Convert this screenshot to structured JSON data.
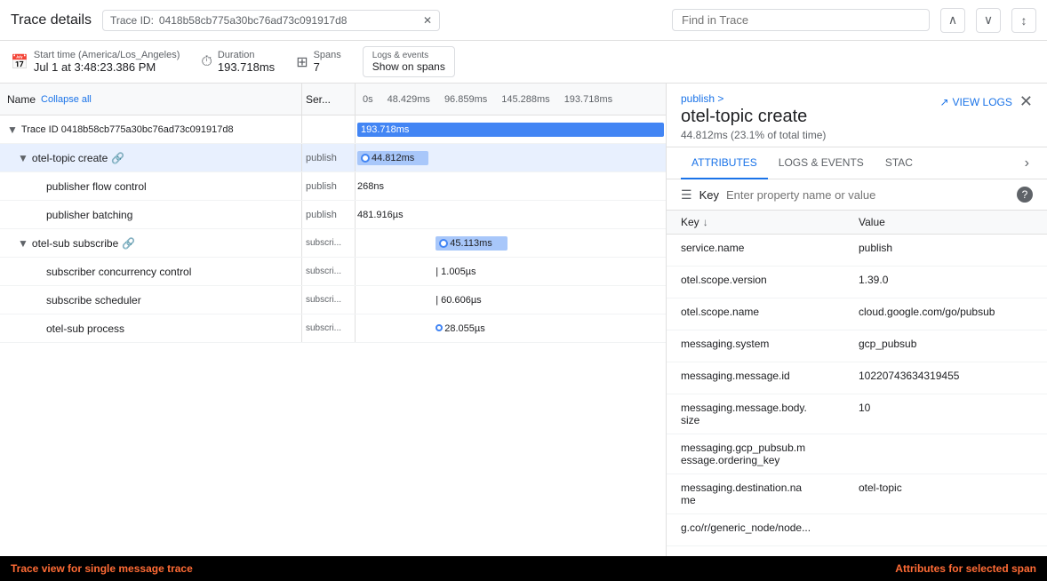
{
  "header": {
    "title": "Trace details",
    "trace_id_label": "Trace ID:",
    "trace_id_value": "0418b58cb775a30bc76ad73c091917d8",
    "find_trace_placeholder": "Find in Trace"
  },
  "meta": {
    "start_label": "Start time (America/Los_Angeles)",
    "start_value": "Jul 1 at 3:48:23.386 PM",
    "duration_label": "Duration",
    "duration_value": "193.718ms",
    "spans_label": "Spans",
    "spans_value": "7",
    "logs_events_label": "Logs & events",
    "logs_events_value": "Show on spans"
  },
  "trace_table": {
    "col_name": "Name",
    "col_collapse": "Collapse all",
    "col_service": "Ser...",
    "timeline_labels": [
      "0s",
      "48.429ms",
      "96.859ms",
      "145.288ms",
      "193.718ms"
    ],
    "rows": [
      {
        "id": "root",
        "indent": 0,
        "name": "Trace ID 0418b58cb775a30bc76ad73c091917d8",
        "service": "",
        "bar_left_pct": 0,
        "bar_width_pct": 100,
        "bar_color": "blue",
        "bar_label": "193.718ms",
        "expanded": true
      },
      {
        "id": "otel-topic-create",
        "indent": 1,
        "name": "otel-topic create",
        "has_link": true,
        "service": "publish",
        "bar_left_pct": 0,
        "bar_width_pct": 23.1,
        "bar_color": "light-blue",
        "bar_label": "44.812ms",
        "expanded": true,
        "has_dot": true,
        "selected": true
      },
      {
        "id": "publisher-flow",
        "indent": 2,
        "name": "publisher flow control",
        "service": "publish",
        "bar_left_pct": 0,
        "bar_width_pct": 0.1,
        "bar_color": "plain",
        "bar_label": "268ns"
      },
      {
        "id": "publisher-batching",
        "indent": 2,
        "name": "publisher batching",
        "service": "publish",
        "bar_left_pct": 0,
        "bar_width_pct": 0.3,
        "bar_color": "plain",
        "bar_label": "481.916µs"
      },
      {
        "id": "otel-sub-subscribe",
        "indent": 1,
        "name": "otel-sub subscribe",
        "has_link": true,
        "service": "subscri...",
        "bar_left_pct": 23.3,
        "bar_width_pct": 23.3,
        "bar_color": "light-blue",
        "bar_label": "45.113ms",
        "expanded": true,
        "has_dot": true
      },
      {
        "id": "subscriber-concurrency",
        "indent": 2,
        "name": "subscriber concurrency control",
        "service": "subscri...",
        "bar_left_pct": 23.3,
        "bar_width_pct": 0.01,
        "bar_color": "plain",
        "bar_label": "1.005µs"
      },
      {
        "id": "subscribe-scheduler",
        "indent": 2,
        "name": "subscribe scheduler",
        "service": "subscri...",
        "bar_left_pct": 23.3,
        "bar_width_pct": 0.3,
        "bar_color": "plain",
        "bar_label": "60.606µs"
      },
      {
        "id": "otel-sub-process",
        "indent": 2,
        "name": "otel-sub process",
        "service": "subscri...",
        "bar_left_pct": 23.3,
        "bar_width_pct": 14.5,
        "bar_color": "plain",
        "bar_label": "28.055µs",
        "has_dot": true
      }
    ]
  },
  "detail_panel": {
    "breadcrumb": "publish >",
    "title": "otel-topic create",
    "subtitle": "44.812ms (23.1% of total time)",
    "view_logs_label": "VIEW LOGS",
    "tabs": [
      "ATTRIBUTES",
      "LOGS & EVENTS",
      "STACK"
    ],
    "active_tab": 0,
    "filter_placeholder": "Enter property name or value",
    "col_key": "Key",
    "col_value": "Value",
    "attributes": [
      {
        "key": "service.name",
        "value": "publish"
      },
      {
        "key": "otel.scope.version",
        "value": "1.39.0"
      },
      {
        "key": "otel.scope.name",
        "value": "cloud.google.com/go/pubsub"
      },
      {
        "key": "messaging.system",
        "value": "gcp_pubsub"
      },
      {
        "key": "messaging.message.id",
        "value": "10220743634319455"
      },
      {
        "key": "messaging.message.body.size",
        "value": "10"
      },
      {
        "key": "messaging.gcp_pubsub.message.ordering_key",
        "value": ""
      },
      {
        "key": "messaging.destination.name",
        "value": "otel-topic"
      },
      {
        "key": "g.co/r/generic_node/node...",
        "value": ""
      }
    ]
  },
  "annotations": {
    "left": "Trace view for single message trace",
    "right": "Attributes for selected span"
  }
}
